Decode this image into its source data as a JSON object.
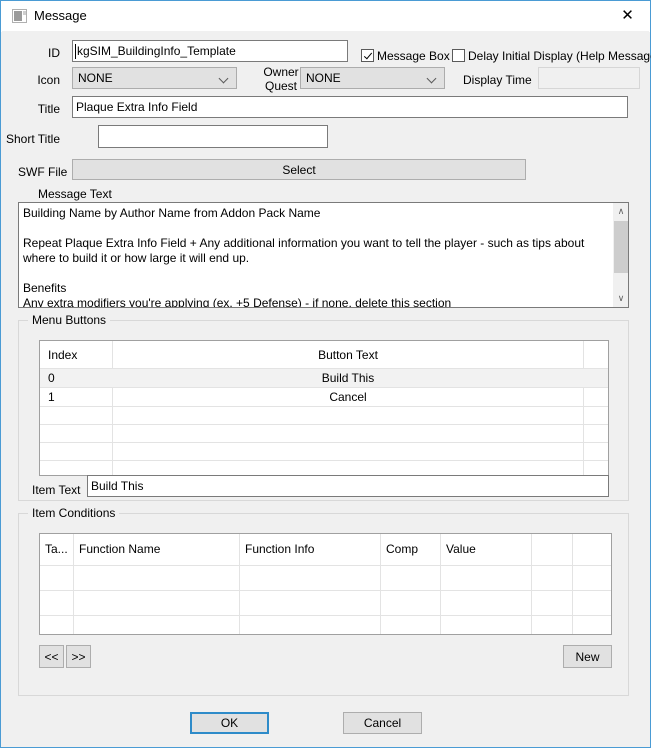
{
  "window": {
    "title": "Message",
    "icon": "window-app-icon",
    "close_label": "✕",
    "border_color": "#4a9bd4"
  },
  "form": {
    "id_label": "ID",
    "id_value": "kgSIM_BuildingInfo_Template",
    "icon_label": "Icon",
    "icon_value": "NONE",
    "owner_quest_label_line1": "Owner",
    "owner_quest_label_line2": "Quest",
    "owner_quest_value": "NONE",
    "display_time_label": "Display Time",
    "display_time_value": "",
    "title_label": "Title",
    "title_value": "Plaque Extra Info Field",
    "short_title_label": "Short Title",
    "short_title_value": "",
    "swf_file_label": "SWF File",
    "swf_select_label": "Select"
  },
  "checkboxes": [
    {
      "name": "message-box",
      "label": "Message Box",
      "checked": true
    },
    {
      "name": "delay-initial-display",
      "label": "Delay Initial Display (Help Message)",
      "checked": false
    }
  ],
  "message_text": {
    "label": "Message Text",
    "value": "Building Name by Author Name from Addon Pack Name\n\nRepeat Plaque Extra Info Field + Any additional information you want to tell the player - such as tips about where to build it or how large it will end up.\n\nBenefits\nAny extra modifiers you're applying (ex. +5 Defense) - if none, delete this section",
    "scroll_up_glyph": "∧",
    "scroll_down_glyph": "∨"
  },
  "menu_buttons": {
    "group_label": "Menu Buttons",
    "columns": [
      "Index",
      "Button Text"
    ],
    "rows": [
      {
        "index": "0",
        "text": "Build This",
        "selected": true
      },
      {
        "index": "1",
        "text": "Cancel",
        "selected": false
      }
    ],
    "item_text_label": "Item Text",
    "item_text_value": "Build This"
  },
  "item_conditions": {
    "group_label": "Item Conditions",
    "columns": [
      "Ta...",
      "Function Name",
      "Function Info",
      "Comp",
      "Value",
      "",
      ""
    ],
    "rows": [],
    "prev_label": "<<",
    "next_label": ">>",
    "new_label": "New"
  },
  "footer": {
    "ok_label": "OK",
    "cancel_label": "Cancel"
  }
}
